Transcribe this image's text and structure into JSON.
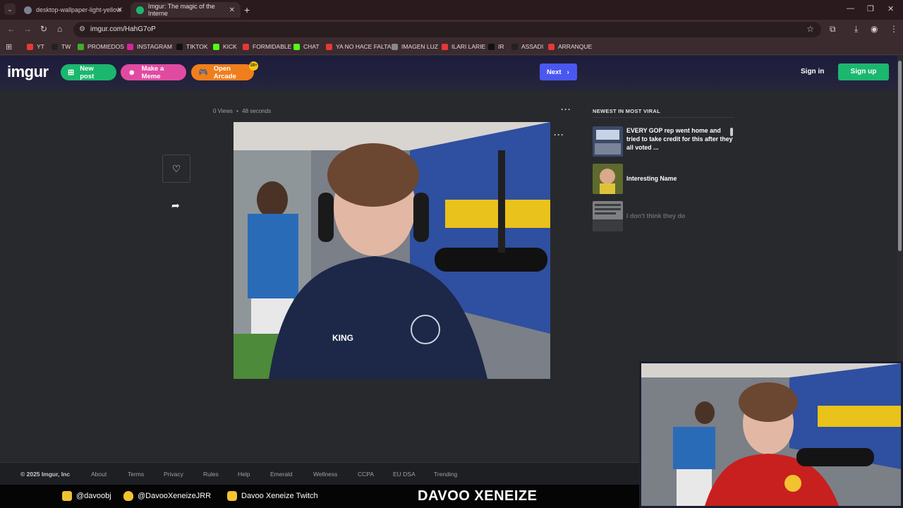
{
  "browser": {
    "tabs": [
      {
        "title": "desktop-wallpaper-light-yellow",
        "favicon_color": "#7a8290"
      },
      {
        "title": "Imgur: The magic of the Interne",
        "favicon_color": "#1bb76e"
      }
    ],
    "url": "imgur.com/HahG7oP",
    "bookmarks": [
      {
        "label": "YT",
        "color": "#e53935"
      },
      {
        "label": "TW",
        "color": "#222222"
      },
      {
        "label": "PROMIEDOS",
        "color": "#3fae2a"
      },
      {
        "label": "INSTAGRAM",
        "color": "#d6249f"
      },
      {
        "label": "TIKTOK",
        "color": "#111111"
      },
      {
        "label": "KICK",
        "color": "#53fc18"
      },
      {
        "label": "FORMIDABLE",
        "color": "#e53935"
      },
      {
        "label": "CHAT",
        "color": "#53fc18"
      },
      {
        "label": "YA NO HACE FALTA",
        "color": "#e53935"
      },
      {
        "label": "IMAGEN LUZ",
        "color": "#888888"
      },
      {
        "label": "ILARI LARIE",
        "color": "#e53935"
      },
      {
        "label": "IR",
        "color": "#111111"
      },
      {
        "label": "ASSADI",
        "color": "#222222"
      },
      {
        "label": "ARRANQUE",
        "color": "#e53935"
      }
    ]
  },
  "header": {
    "logo": "imgur",
    "new_post": "New post",
    "make_meme": "Make a Meme",
    "open_arcade": "Open Arcade",
    "arcade_badge": "18+",
    "next": "Next",
    "sign_in": "Sign in",
    "sign_up": "Sign up"
  },
  "post": {
    "views": "0 Views",
    "age": "48 seconds"
  },
  "sidebar": {
    "title": "NEWEST IN MOST VIRAL",
    "items": [
      {
        "title": "EVERY GOP rep went home and tried to take credit for this after they all voted ..."
      },
      {
        "title": "Interesting Name"
      },
      {
        "title": "I don't think they do"
      }
    ]
  },
  "footer": {
    "copyright": "© 2025 Imgur, Inc",
    "links": [
      "About",
      "Terms",
      "Privacy",
      "Rules",
      "Help",
      "Emerald",
      "Wellness",
      "CCPA",
      "EU DSA",
      "Trending"
    ]
  },
  "overlay": {
    "instagram": "@davoobj",
    "twitter": "@DavooXeneizeJRR",
    "twitch": "Davoo Xeneize Twitch",
    "brand": "DAVOO XENEIZE"
  }
}
